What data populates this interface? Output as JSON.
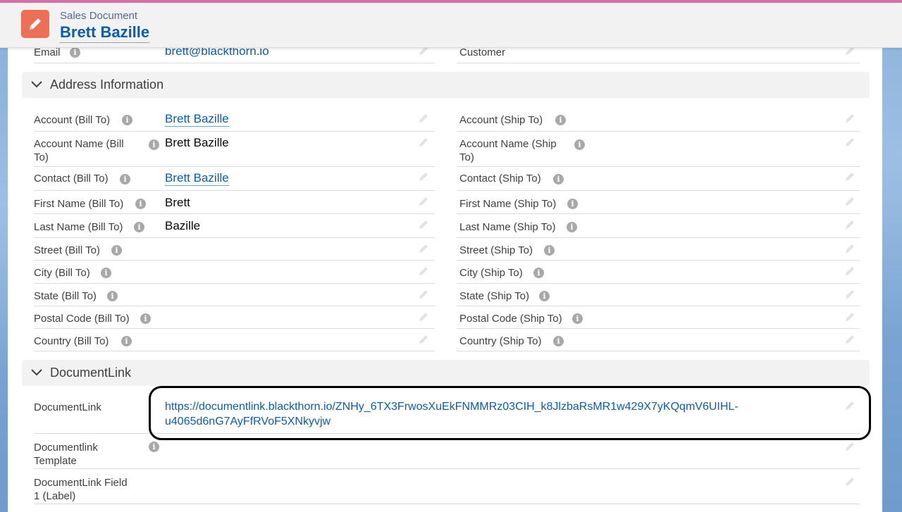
{
  "header": {
    "eyebrow": "Sales Document",
    "title": "Brett Bazille",
    "icon": "pencil-icon",
    "icon_color": "#ec6f56",
    "accent_strip": "#d56ea5"
  },
  "top_fields": {
    "left": {
      "label": "Email",
      "value": "brett@blackthorn.io"
    },
    "right": {
      "label": "Customer",
      "value": ""
    }
  },
  "address_section": {
    "title": "Address Information",
    "left": [
      {
        "label": "Account (Bill To)",
        "value": "Brett Bazille"
      },
      {
        "label_l1": "Account Name (Bill",
        "label_l2": "To)",
        "value": "Brett Bazille"
      },
      {
        "label": "Contact (Bill To)",
        "value": "Brett Bazille"
      },
      {
        "label": "First Name (Bill To)",
        "value": "Brett"
      },
      {
        "label": "Last Name (Bill To)",
        "value": "Bazille"
      },
      {
        "label": "Street (Bill To)",
        "value": ""
      },
      {
        "label": "City (Bill To)",
        "value": ""
      },
      {
        "label": "State (Bill To)",
        "value": ""
      },
      {
        "label": "Postal Code (Bill To)",
        "value": ""
      },
      {
        "label": "Country (Bill To)",
        "value": ""
      }
    ],
    "right": [
      {
        "label": "Account (Ship To)"
      },
      {
        "label_l1": "Account Name (Ship",
        "label_l2": "To)"
      },
      {
        "label": "Contact (Ship To)"
      },
      {
        "label": "First Name (Ship To)"
      },
      {
        "label": "Last Name (Ship To)"
      },
      {
        "label": "Street (Ship To)"
      },
      {
        "label": "City (Ship To)"
      },
      {
        "label": "State (Ship To)"
      },
      {
        "label": "Postal Code (Ship To)"
      },
      {
        "label": "Country (Ship To)"
      }
    ]
  },
  "documentlink_section": {
    "title": "DocumentLink",
    "fields": [
      {
        "label": "DocumentLink",
        "value_l1": "https://documentlink.blackthorn.io/ZNHy_6TX3FrwosXuEkFNMMRz03CIH_k8JlzbaRsMR1w429X7yKQqmV6UIHL-",
        "value_l2": "u4065d6nG7AyFfRVoF5XNkyvjw"
      },
      {
        "label_l1": "Documentlink",
        "label_l2": "Template"
      },
      {
        "label_l1": "DocumentLink Field",
        "label_l2": "1 (Label)"
      }
    ]
  },
  "colors": {
    "link": "#0b5cab",
    "label": "#3e3e3c",
    "divider": "#dddbda",
    "section_bg": "#f3f2f2"
  }
}
